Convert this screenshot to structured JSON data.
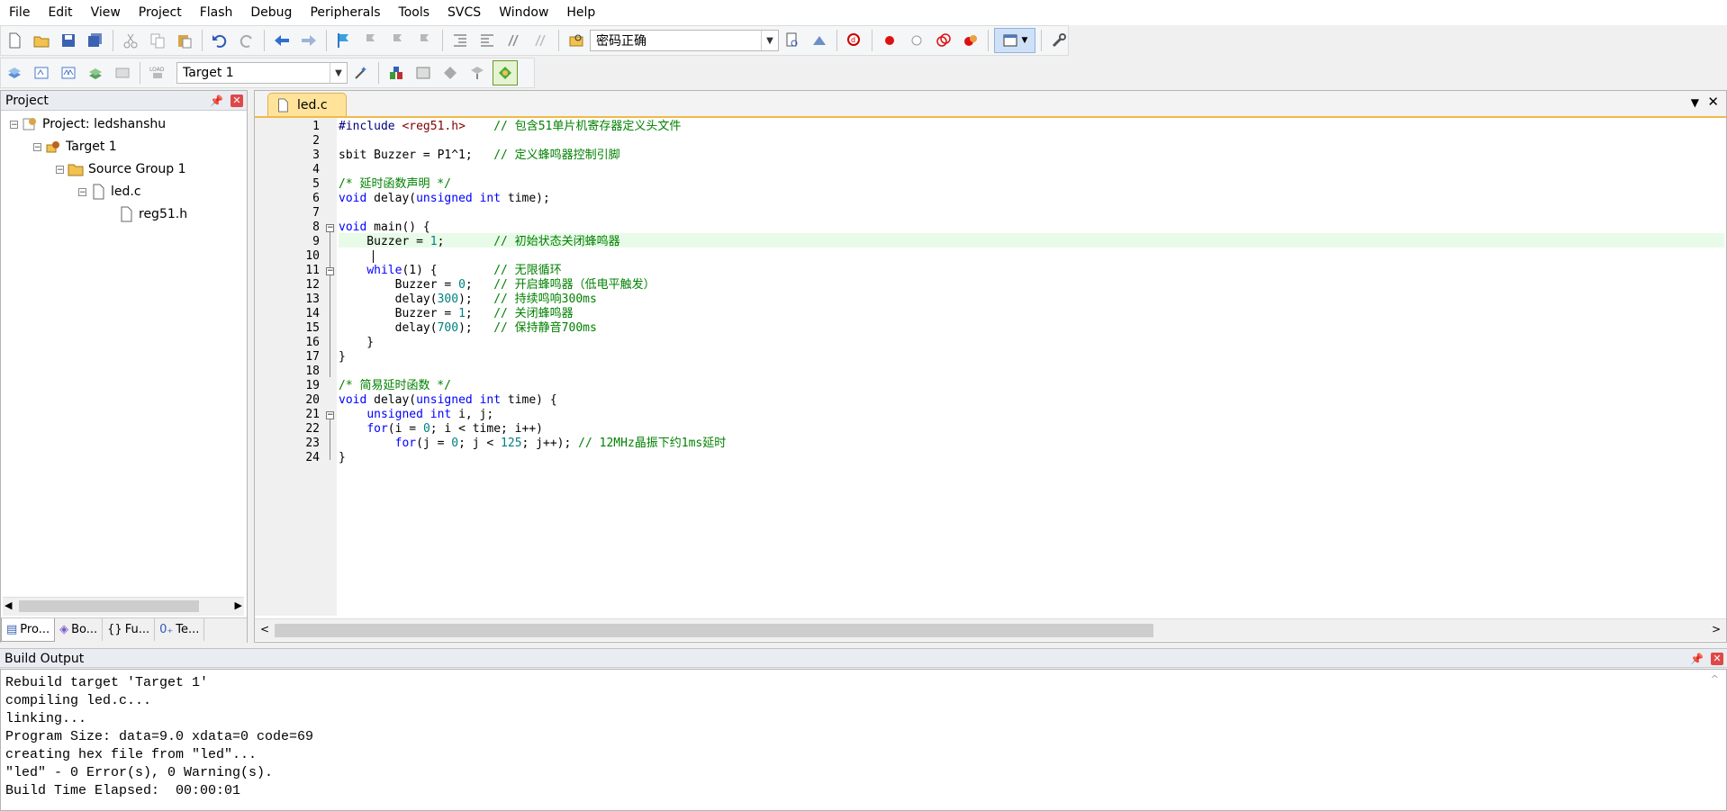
{
  "menu": [
    "File",
    "Edit",
    "View",
    "Project",
    "Flash",
    "Debug",
    "Peripherals",
    "Tools",
    "SVCS",
    "Window",
    "Help"
  ],
  "toolbar1": {
    "find_combo_value": "密码正确"
  },
  "toolbar2": {
    "target_combo_value": "Target 1"
  },
  "project_panel": {
    "title": "Project",
    "tree": [
      {
        "label": "Project: ledshanshu",
        "level": 0
      },
      {
        "label": "Target 1",
        "level": 1
      },
      {
        "label": "Source Group 1",
        "level": 2
      },
      {
        "label": "led.c",
        "level": 3
      },
      {
        "label": "reg51.h",
        "level": 4
      }
    ],
    "tabs": [
      "Pro...",
      "Bo...",
      "Fu...",
      "Te..."
    ]
  },
  "editor": {
    "file_tab": "led.c",
    "line_numbers": [
      "1",
      "2",
      "3",
      "4",
      "5",
      "6",
      "7",
      "8",
      "9",
      "10",
      "11",
      "12",
      "13",
      "14",
      "15",
      "16",
      "17",
      "18",
      "19",
      "20",
      "21",
      "22",
      "23",
      "24"
    ],
    "lines": {
      "l1a": "#include ",
      "l1b": "<reg51.h>",
      "l1c": "    // 包含51单片机寄存器定义头文件",
      "l3a": "sbit Buzzer = P1^1;",
      "l3c": "   // 定义蜂鸣器控制引脚",
      "l5c": "/* 延时函数声明 */",
      "l6a": "void",
      "l6b": " delay(",
      "l6c": "unsigned",
      "l6d": " ",
      "l6e": "int",
      "l6f": " time);",
      "l8a": "void",
      "l8b": " main() {",
      "l9a": "    Buzzer = ",
      "l9b": "1",
      "l9c": ";",
      "l9d": "       // 初始状态关闭蜂鸣器",
      "l11a": "    ",
      "l11b": "while",
      "l11c": "(1) {",
      "l11d": "        // 无限循环",
      "l12a": "        Buzzer = ",
      "l12b": "0",
      "l12c": ";",
      "l12d": "   // 开启蜂鸣器（低电平触发）",
      "l13a": "        delay(",
      "l13b": "300",
      "l13c": ");",
      "l13d": "   // 持续鸣响300ms",
      "l14a": "        Buzzer = ",
      "l14b": "1",
      "l14c": ";",
      "l14d": "   // 关闭蜂鸣器",
      "l15a": "        delay(",
      "l15b": "700",
      "l15c": ");",
      "l15d": "   // 保持静音700ms",
      "l16a": "    }",
      "l17a": "}",
      "l19c": "/* 简易延时函数 */",
      "l20a": "void",
      "l20b": " delay(",
      "l20c": "unsigned",
      "l20d": " ",
      "l20e": "int",
      "l20f": " time) {",
      "l21a": "    ",
      "l21b": "unsigned",
      "l21c": " ",
      "l21d": "int",
      "l21e": " i, j;",
      "l22a": "    ",
      "l22b": "for",
      "l22c": "(i = ",
      "l22d": "0",
      "l22e": "; i < time; i++)",
      "l23a": "        ",
      "l23b": "for",
      "l23c": "(j = ",
      "l23d": "0",
      "l23e": "; j < ",
      "l23f": "125",
      "l23g": "; j++);",
      "l23h": " // 12MHz晶振下约1ms延时",
      "l24a": "}"
    }
  },
  "build_output": {
    "title": "Build Output",
    "lines": [
      "Rebuild target 'Target 1'",
      "compiling led.c...",
      "linking...",
      "Program Size: data=9.0 xdata=0 code=69",
      "creating hex file from \"led\"...",
      "\"led\" - 0 Error(s), 0 Warning(s).",
      "Build Time Elapsed:  00:00:01"
    ]
  }
}
